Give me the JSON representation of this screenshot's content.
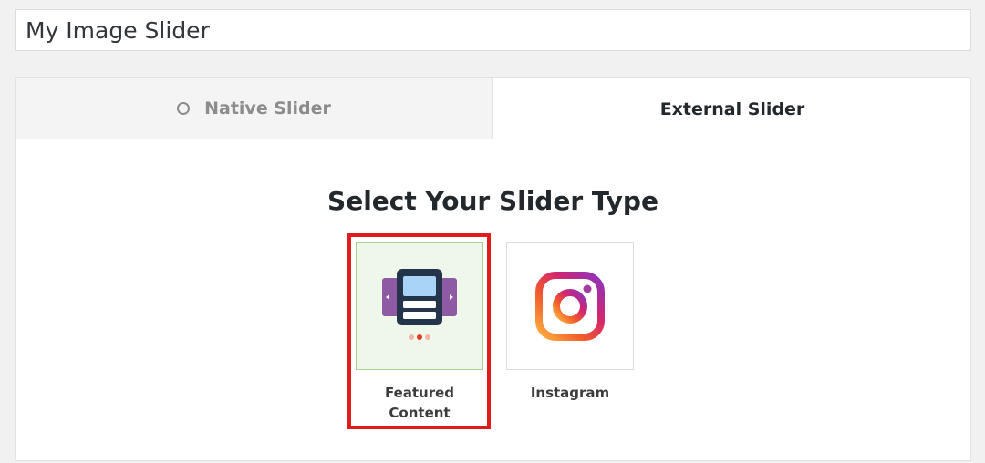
{
  "slider_title": {
    "value": "My Image Slider"
  },
  "tabs": [
    {
      "label": "Native Slider",
      "state": "inactive"
    },
    {
      "label": "External Slider",
      "state": "active"
    }
  ],
  "main": {
    "heading": "Select Your Slider Type",
    "types": [
      {
        "label": "Featured Content",
        "icon": "featured-content-slider-icon",
        "selected": true
      },
      {
        "label": "Instagram",
        "icon": "instagram-icon",
        "selected": false
      }
    ]
  },
  "colors": {
    "selected_tile_bg": "#eef7e9",
    "highlight_border": "#e01b1b",
    "slider_icon_purple": "#8e5aa3",
    "slider_icon_navy": "#23344b",
    "slider_icon_screen": "#a9d3f7"
  }
}
